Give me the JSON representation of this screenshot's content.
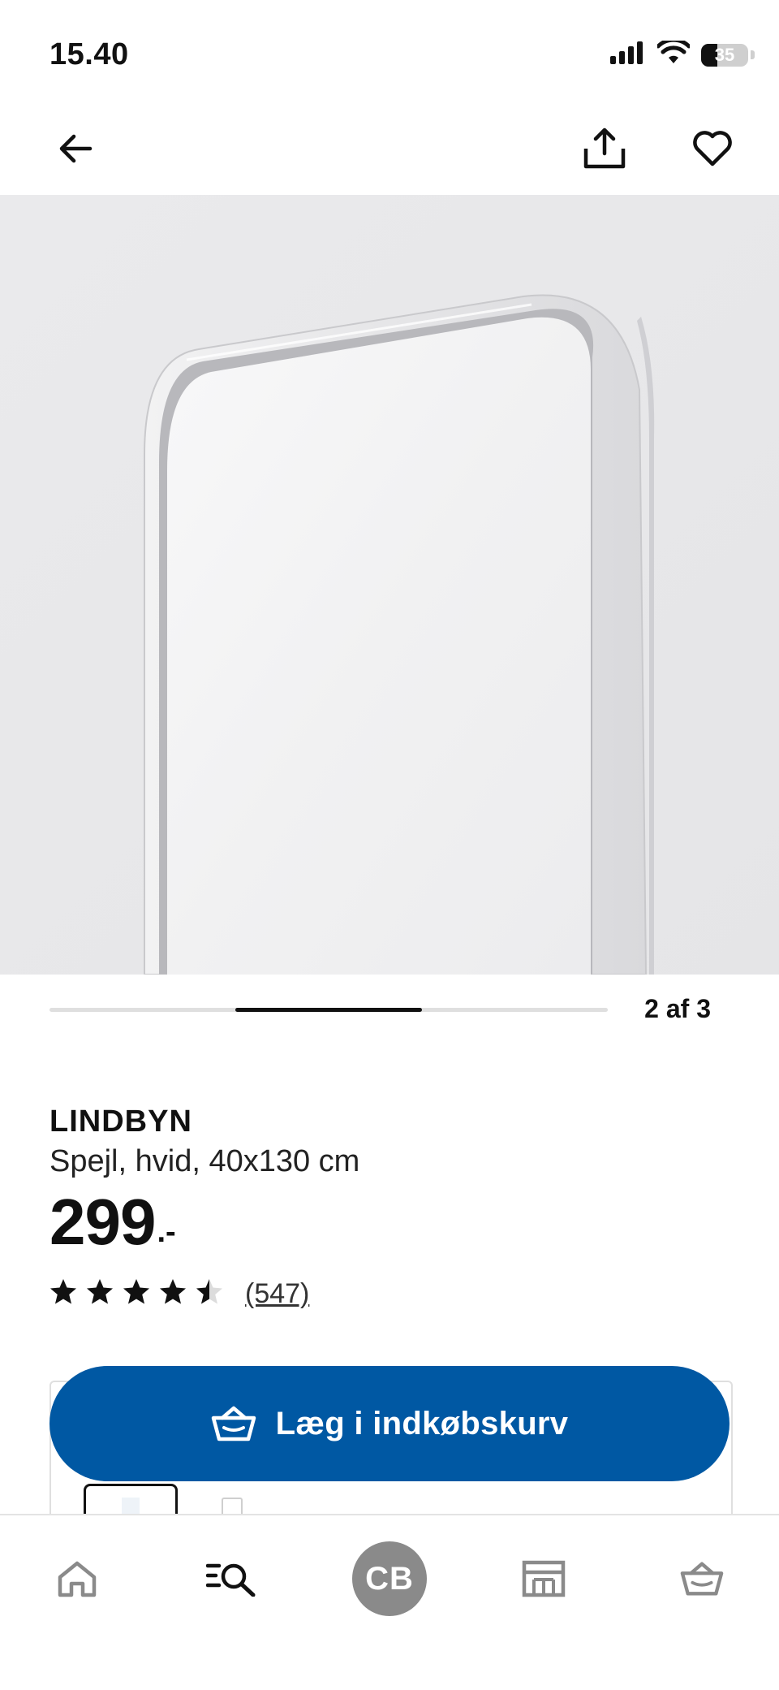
{
  "status_bar": {
    "time": "15.40",
    "battery_percent": "35",
    "battery_level": 0.35
  },
  "top_nav": {
    "icons": [
      "back-arrow-icon",
      "share-icon",
      "heart-icon"
    ]
  },
  "carousel": {
    "counter": "2 af 3",
    "current": 2,
    "total": 3
  },
  "product": {
    "name": "LINDBYN",
    "description": "Spejl, hvid, 40x130 cm",
    "price": "299",
    "price_suffix": ".-",
    "rating": 4.5,
    "rating_max": 5,
    "review_count": "(547)"
  },
  "actions": {
    "add_to_cart_label": "Læg i indkøbskurv"
  },
  "tab_bar": {
    "tabs": [
      "home-icon",
      "search-icon",
      "profile-avatar",
      "store-icon",
      "basket-icon"
    ],
    "avatar_initials": "CB"
  },
  "colors": {
    "primary_blue": "#0058a3",
    "text": "#111111",
    "avatar_gray": "#8a8a8a"
  }
}
